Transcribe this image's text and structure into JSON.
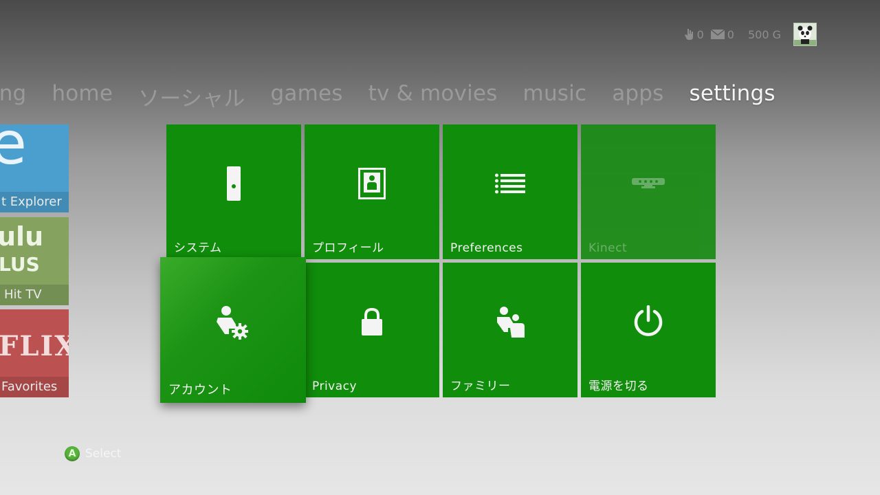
{
  "status": {
    "friends_count": "0",
    "messages_count": "0",
    "gamerscore": "500 G"
  },
  "nav": {
    "tabs": [
      "ping",
      "home",
      "ソーシャル",
      "games",
      "tv & movies",
      "music",
      "apps",
      "settings"
    ],
    "active": "settings"
  },
  "side_apps": [
    {
      "name": "t Explorer",
      "big": "e",
      "color": "#4a9fcf"
    },
    {
      "name": "Hit TV",
      "big": "ulu",
      "big2": "LUS",
      "color": "#85a35f"
    },
    {
      "name": "Favorites",
      "big": "FLIX",
      "color": "#bc5151"
    }
  ],
  "tiles": [
    {
      "label": "システム",
      "icon": "console-icon"
    },
    {
      "label": "プロフィール",
      "icon": "profile-icon"
    },
    {
      "label": "Preferences",
      "icon": "list-icon"
    },
    {
      "label": "Kinect",
      "icon": "kinect-sensor-icon"
    },
    {
      "label": "アカウント",
      "icon": "account-settings-icon"
    },
    {
      "label": "Privacy",
      "icon": "lock-icon"
    },
    {
      "label": "ファミリー",
      "icon": "family-icon"
    },
    {
      "label": "電源を切る",
      "icon": "power-icon"
    }
  ],
  "hint": {
    "button": "A",
    "action": "Select"
  },
  "colors": {
    "tile_green": "#108d0b",
    "a_button": "#57b43a"
  }
}
